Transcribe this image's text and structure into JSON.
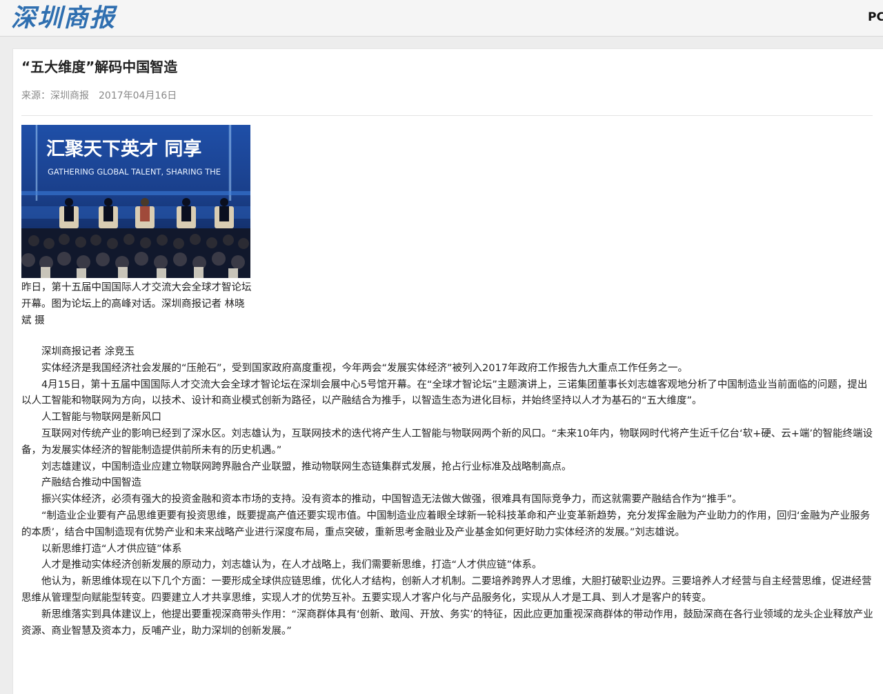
{
  "site": {
    "logo": "深圳商报",
    "pc_link": "PC"
  },
  "article": {
    "title": "“五大维度”解码中国智造",
    "source": "来源：深圳商报",
    "date": "2017年04月16日",
    "photo": {
      "headline_cn": "汇聚天下英才  同享",
      "headline_en": "GATHERING GLOBAL TALENT, SHARING THE",
      "caption": "昨日，第十五届中国国际人才交流大会全球才智论坛开幕。图为论坛上的高峰对话。深圳商报记者 林晓斌 摄"
    },
    "paragraphs": [
      "深圳商报记者 涂竞玉",
      "实体经济是我国经济社会发展的“压舱石”，受到国家政府高度重视，今年两会“发展实体经济”被列入2017年政府工作报告九大重点工作任务之一。",
      "4月15日，第十五届中国国际人才交流大会全球才智论坛在深圳会展中心5号馆开幕。在“全球才智论坛”主题演讲上，三诺集团董事长刘志雄客观地分析了中国制造业当前面临的问题，提出以人工智能和物联网为方向，以技术、设计和商业模式创新为路径，以产融结合为推手，以智造生态为进化目标，并始终坚持以人才为基石的“五大维度”。",
      "人工智能与物联网是新风口",
      "互联网对传统产业的影响已经到了深水区。刘志雄认为，互联网技术的迭代将产生人工智能与物联网两个新的风口。“未来10年内，物联网时代将产生近千亿台‘软+硬、云+端’的智能终端设备，为发展实体经济的智能制造提供前所未有的历史机遇。”",
      "刘志雄建议，中国制造业应建立物联网跨界融合产业联盟，推动物联网生态链集群式发展，抢占行业标准及战略制高点。",
      "产融结合推动中国智造",
      "振兴实体经济，必须有强大的投资金融和资本市场的支持。没有资本的推动，中国智造无法做大做强，很难具有国际竞争力，而这就需要产融结合作为“推手”。",
      "“制造业企业要有产品思维更要有投资思维，既要提高产值还要实现市值。中国制造业应着眼全球新一轮科技革命和产业变革新趋势，充分发挥金融为产业助力的作用，回归‘金融为产业服务的本质’，结合中国制造现有优势产业和未来战略产业进行深度布局，重点突破，重新思考金融业及产业基金如何更好助力实体经济的发展。”刘志雄说。",
      "以新思维打造“人才供应链”体系",
      "人才是推动实体经济创新发展的原动力，刘志雄认为，在人才战略上，我们需要新思维，打造“人才供应链”体系。",
      "他认为，新思维体现在以下几个方面：一要形成全球供应链思维，优化人才结构，创新人才机制。二要培养跨界人才思维，大胆打破职业边界。三要培养人才经营与自主经营思维，促进经营思维从管理型向赋能型转变。四要建立人才共享思维，实现人才的优势互补。五要实现人才客户化与产品服务化，实现从人才是工具、到人才是客户的转变。",
      "新思维落实到具体建议上，他提出要重视深商带头作用：“深商群体具有‘创新、敢闯、开放、务实’的特征，因此应更加重视深商群体的带动作用，鼓励深商在各行业领域的龙头企业释放产业资源、商业智慧及资本力，反哺产业，助力深圳的创新发展。”"
    ]
  },
  "colors": {
    "logo": "#2f6fb0",
    "page_bg": "#ededed",
    "photo_backdrop": "#1a3f8a"
  }
}
